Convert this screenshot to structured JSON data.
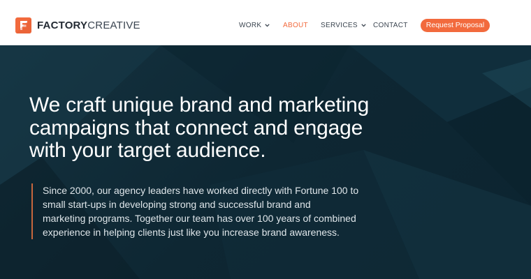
{
  "header": {
    "logo": {
      "bold": "FACTORY",
      "light": "CREATIVE",
      "mark_letter": "F"
    },
    "nav": [
      {
        "label": "WORK",
        "has_dropdown": true,
        "active": false
      },
      {
        "label": "ABOUT",
        "has_dropdown": false,
        "active": true
      },
      {
        "label": "SERVICES",
        "has_dropdown": true,
        "active": false
      },
      {
        "label": "CONTACT",
        "has_dropdown": false,
        "active": false
      }
    ],
    "cta_label": "Request Proposal"
  },
  "hero": {
    "headline_lines": [
      "We craft unique brand and marketing",
      "campaigns that connect and engage",
      "with your target audience."
    ],
    "body_lines": [
      "Since 2000, our agency leaders have worked directly with  Fortune 100 to",
      "small start-ups in developing strong and successful brand and",
      "marketing programs. Together our team has over 100 years of combined",
      "experience in helping  clients just like you increase brand awareness."
    ]
  },
  "colors": {
    "accent": "#f26a3d",
    "hero_bg": "#0f2a38",
    "header_bg": "#ffffff",
    "nav_text": "#3b4550"
  },
  "icons": [
    "logo-f-mark",
    "chevron-down-icon"
  ]
}
